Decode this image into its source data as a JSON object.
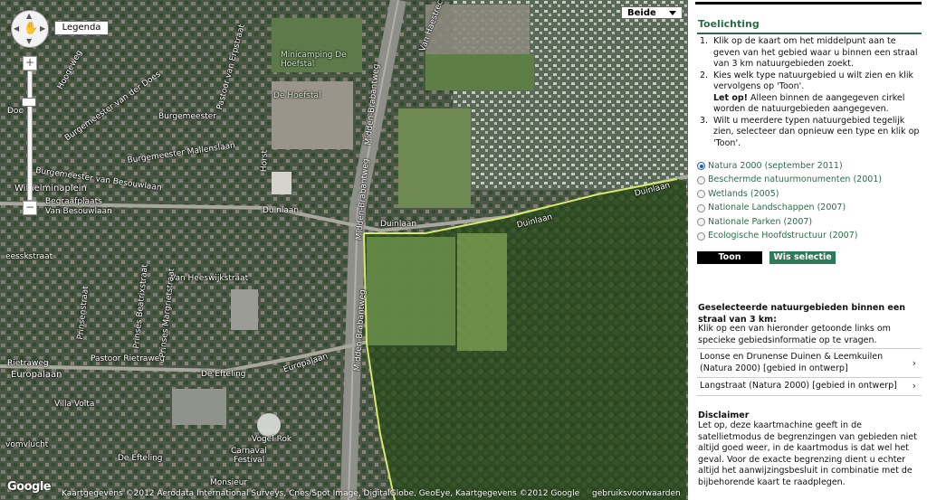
{
  "map": {
    "legend_label": "Legenda",
    "maptype_label": "Beide",
    "zoom_in": "+",
    "zoom_out": "−",
    "google_logo": "Google",
    "attribution": "Kaartgegevens ©2012 Aerodata International Surveys, Cnes/Spot Image, DigitalGlobe, GeoEye, Kaartgegevens ©2012 Google",
    "terms": "gebruiksvoorwaarden",
    "labels": {
      "hogeweg": "Hoogeweg",
      "burg_van_der_does": "Burgemeester van der Does",
      "burgemeester": "Burgemeester",
      "burg_mallenslaan": "Burgemeester Mallenslaan",
      "burg_van_besouwlaan": "Burgemeester van Besouwlaan",
      "willeminaplein": "Wilhelminaplein",
      "begraafplaats": "Begraafplaats Van Besouwlaan",
      "doc": "Doc",
      "dunlaan1": "Duinlaan",
      "dunlaan2": "Duinlaan",
      "dunlaan3": "Duinlaan",
      "dunlaan4": "Duinlaan",
      "van_heeswijkstraat": "Van Heeswijkstraat",
      "van_haestrechtstraat": "Van Haestrechtstraat",
      "midden_brabantweg1": "Midden-Brabantweg",
      "midden_brabantweg2": "Midden-Brabantweg",
      "europalaan1": "Europalaan",
      "europalaan2": "Europalaan",
      "rietraweg": "Rietraweg",
      "pastoor_rietraweg": "Pastoor Rietraweg",
      "de_efteling1": "De Efteling",
      "de_efteling2": "De Efteling",
      "villa_volta": "Villa Volta",
      "vogel_rok": "Vogel Rok",
      "carnaval": "Carnaval",
      "festival": "Festival",
      "monsieur": "Monsieur",
      "minicamping": "Minicamping De Hoefstal",
      "de_hoefstal": "De Hoefstal",
      "eesskstraat": "eesskstraat",
      "prinses_beatrixstraat": "Prinses Beatrixstraat",
      "prinses_margrietstraat": "Prinses Margrietstraat",
      "pastoor_van_erpstraat": "Pastoor van Erpstraat",
      "horst": "Horst",
      "prinsenstraat": "Prinsenstraat",
      "vronlucht": "vomvlucht"
    }
  },
  "panel": {
    "title": "Toelichting",
    "steps": [
      {
        "num": "1.",
        "text": "Klik op de kaart om het middelpunt aan te geven van het gebied waar u binnen een straal van 3 km natuurgebieden zoekt."
      },
      {
        "num": "2.",
        "text": "Kies welk type natuurgebied u wilt zien en klik vervolgens op 'Toon'.",
        "note_strong": "Let op!",
        "note": " Alleen binnen de aangegeven cirkel worden de natuurgebieden aangegeven."
      },
      {
        "num": "3.",
        "text": "Wilt u meerdere typen natuurgebied tegelijk zien, selecteer dan opnieuw een type en klik op 'Toon'."
      }
    ],
    "radios": [
      {
        "label": "Natura 2000 (september 2011)",
        "selected": true
      },
      {
        "label": "Beschermde natuurmonumenten (2001)",
        "selected": false
      },
      {
        "label": "Wetlands (2005)",
        "selected": false
      },
      {
        "label": "Nationale Landschappen (2007)",
        "selected": false
      },
      {
        "label": "Nationale Parken (2007)",
        "selected": false
      },
      {
        "label": "Ecologische Hoofdstructuur (2007)",
        "selected": false
      }
    ],
    "toon_label": "Toon",
    "wis_label": "Wis selectie",
    "selected_title": "Geselecteerde natuurgebieden binnen een straal van 3 km:",
    "selected_help": "Klik op een van hieronder getoonde links om specieke gebiedsinformatie op te vragen.",
    "results": [
      {
        "label": "Loonse en Drunense Duinen & Leemkuilen (Natura 2000) [gebied in ontwerp]",
        "chevron": "›"
      },
      {
        "label": "Langstraat (Natura 2000) [gebied in ontwerp]",
        "chevron": "›"
      }
    ],
    "disclaimer_title": "Disclaimer",
    "disclaimer_text": "Let op, deze kaartmachine geeft in de satellietmodus de begrenzingen van gebieden niet altijd goed weer, in de kaartmodus is dat wel het geval. Voor de exacte begrenzing dient u echter altijd het aanwijzingsbesluit in combinatie met de bijbehorende kaart te raadplegen."
  }
}
